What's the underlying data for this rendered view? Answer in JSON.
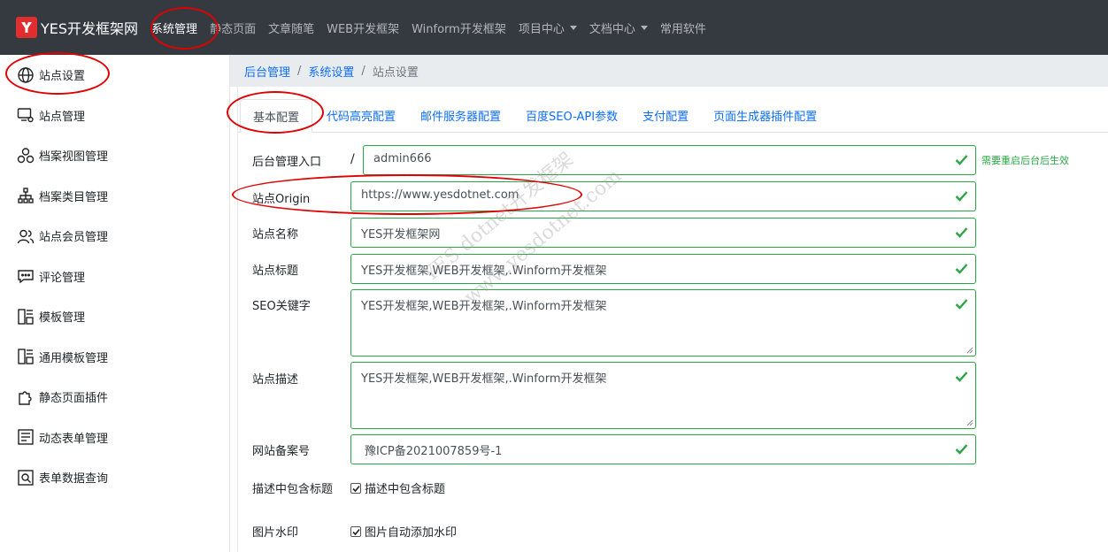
{
  "navbar": {
    "brand": "YES开发框架网",
    "items": [
      {
        "label": "系统管理",
        "active": true,
        "dropdown": false
      },
      {
        "label": "静态页面",
        "active": false,
        "dropdown": false
      },
      {
        "label": "文章随笔",
        "active": false,
        "dropdown": false
      },
      {
        "label": "WEB开发框架",
        "active": false,
        "dropdown": false
      },
      {
        "label": "Winform开发框架",
        "active": false,
        "dropdown": false
      },
      {
        "label": "项目中心",
        "active": false,
        "dropdown": true
      },
      {
        "label": "文档中心",
        "active": false,
        "dropdown": true
      },
      {
        "label": "常用软件",
        "active": false,
        "dropdown": false
      }
    ]
  },
  "sidebar": {
    "items": [
      {
        "label": "站点设置",
        "icon": "globe-icon"
      },
      {
        "label": "站点管理",
        "icon": "monitor-gear-icon"
      },
      {
        "label": "档案视图管理",
        "icon": "circles-icon"
      },
      {
        "label": "档案类目管理",
        "icon": "sitemap-icon"
      },
      {
        "label": "站点会员管理",
        "icon": "users-icon"
      },
      {
        "label": "评论管理",
        "icon": "comment-icon"
      },
      {
        "label": "模板管理",
        "icon": "template-icon"
      },
      {
        "label": "通用模板管理",
        "icon": "template-icon"
      },
      {
        "label": "静态页面插件",
        "icon": "puzzle-icon"
      },
      {
        "label": "动态表单管理",
        "icon": "form-icon"
      },
      {
        "label": "表单数据查询",
        "icon": "search-doc-icon"
      }
    ]
  },
  "breadcrumb": {
    "items": [
      "后台管理",
      "系统设置"
    ],
    "separator": "/",
    "current": "站点设置"
  },
  "tabs": [
    {
      "label": "基本配置",
      "active": true
    },
    {
      "label": "代码高亮配置",
      "active": false
    },
    {
      "label": "邮件服务器配置",
      "active": false
    },
    {
      "label": "百度SEO-API参数",
      "active": false
    },
    {
      "label": "支付配置",
      "active": false
    },
    {
      "label": "页面生成器插件配置",
      "active": false
    }
  ],
  "form": {
    "admin_entry": {
      "label": "后台管理入口",
      "prefix": "/",
      "value": "admin666",
      "hint": "需要重启后台后生效"
    },
    "origin": {
      "label": "站点Origin",
      "value": "https://www.yesdotnet.com"
    },
    "name": {
      "label": "站点名称",
      "value": "YES开发框架网"
    },
    "title": {
      "label": "站点标题",
      "value": "YES开发框架,WEB开发框架,.Winform开发框架"
    },
    "keywords": {
      "label": "SEO关键字",
      "value": "YES开发框架,WEB开发框架,.Winform开发框架"
    },
    "description": {
      "label": "站点描述",
      "value": "YES开发框架,WEB开发框架,.Winform开发框架"
    },
    "icp": {
      "label": "网站备案号",
      "value": "豫ICP备2021007859号-1"
    },
    "desc_title": {
      "label": "描述中包含标题",
      "checkbox_label": "描述中包含标题",
      "checked": true
    },
    "watermark": {
      "label": "图片水印",
      "checkbox_label": "图片自动添加水印",
      "checked": true
    }
  },
  "watermark_text": {
    "line1": "YES  dotnet开发框架",
    "line2": "www.yesdotnet.com"
  },
  "colors": {
    "navbar_bg": "#343a40",
    "accent": "#0d6efd",
    "valid": "#28a745",
    "annotation": "#e10000",
    "logo": "#e02d2d"
  }
}
